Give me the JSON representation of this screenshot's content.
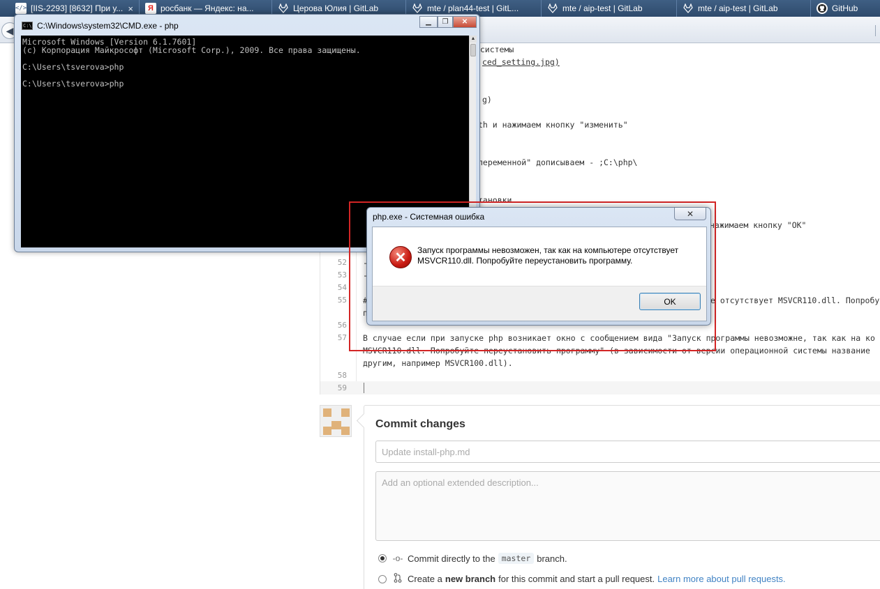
{
  "tabs": [
    {
      "label": "[IIS-2293] [8632] При у...",
      "icon": "code-icon"
    },
    {
      "label": "росбанк — Яндекс: на...",
      "icon": "yandex-icon"
    },
    {
      "label": "Церова Юлия | GitLab",
      "icon": "gitlab-icon"
    },
    {
      "label": "mte / plan44-test | GitL...",
      "icon": "gitlab-icon"
    },
    {
      "label": "mte / aip-test | GitLab",
      "icon": "gitlab-icon"
    },
    {
      "label": "mte / aip-test | GitLab",
      "icon": "gitlab-icon"
    },
    {
      "label": "GitHub",
      "icon": "github-icon"
    }
  ],
  "editor": {
    "lines": [
      {
        "num": "",
        "text": "ы системы"
      },
      {
        "num": "",
        "text": "ced_setting.jpg)"
      },
      {
        "num": "",
        "text": "g)"
      },
      {
        "num": "",
        "text": "th и нажимаем кнопку \"изменить\""
      },
      {
        "num": "",
        "text": "переменной\" дописываем - ;C:\\php\\"
      },
      {
        "num": "",
        "text": "тановки"
      },
      {
        "num": "",
        "text": "нажимаем кнопку \"ОК\""
      },
      {
        "num": "52",
        "text": "-"
      },
      {
        "num": "53",
        "text": "-"
      },
      {
        "num": "54",
        "text": ""
      },
      {
        "num": "55",
        "text": "#"
      },
      {
        "num": "",
        "text": "е отсутствует MSVCR110.dll. Попробуй"
      },
      {
        "num": "",
        "text": "п"
      },
      {
        "num": "56",
        "text": ""
      },
      {
        "num": "57",
        "text": "В случае если при запуске php возникает окно с сообщением вида \"Запуск программы невозможне, так как на ко"
      },
      {
        "num": "",
        "text": "MSVCR110.dll. Попробуйте переустановить программу\" (в зависимости от версии операционной системы название"
      },
      {
        "num": "",
        "text": "другим, например MSVCR100.dll)."
      },
      {
        "num": "58",
        "text": ""
      },
      {
        "num": "59",
        "text": ""
      }
    ]
  },
  "commit": {
    "title": "Commit changes",
    "summary_placeholder": "Update install-php.md",
    "description_placeholder": "Add an optional extended description...",
    "option1_prefix": "Commit directly to the",
    "option1_branch": "master",
    "option1_suffix": "branch.",
    "option2_prefix": "Create a",
    "option2_bold": "new branch",
    "option2_suffix": "for this commit and start a pull request.",
    "option2_link": "Learn more about pull requests."
  },
  "cmd": {
    "title": "C:\\Windows\\system32\\CMD.exe - php",
    "lines": [
      "Microsoft Windows [Version 6.1.7601]",
      "(c) Корпорация Майкрософт (Microsoft Corp.), 2009. Все права защищены.",
      "",
      "C:\\Users\\tsverova>php",
      "",
      "C:\\Users\\tsverova>php"
    ]
  },
  "error_dialog": {
    "title": "php.exe - Системная ошибка",
    "close_label": "✕",
    "message": "Запуск программы невозможен, так как на компьютере отсутствует MSVCR110.dll. Попробуйте переустановить программу.",
    "ok_label": "OK"
  },
  "colors": {
    "highlight": "#d32525",
    "link": "#4183c4",
    "error_icon": "#c91a12"
  }
}
